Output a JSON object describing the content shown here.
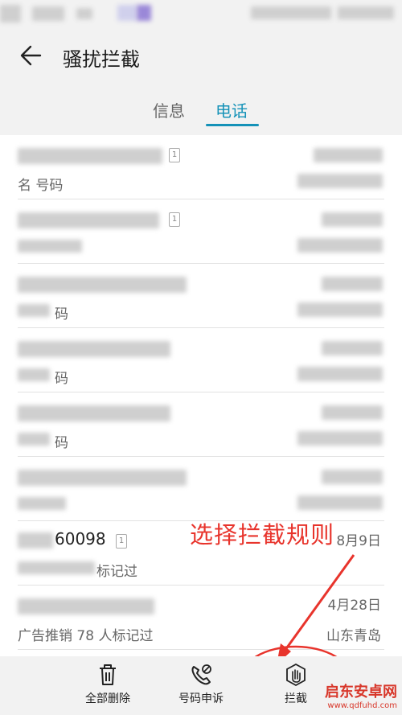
{
  "header": {
    "title": "骚扰拦截"
  },
  "tabs": [
    {
      "label": "信息"
    },
    {
      "label": "电话"
    }
  ],
  "rows": [
    {
      "sub": "名 号码"
    },
    {
      "sub": ""
    },
    {
      "sub": "码"
    },
    {
      "sub": "码"
    },
    {
      "sub": "码"
    },
    {
      "sub": ""
    },
    {
      "number": "60098",
      "sub": "标记过",
      "date": "8月9日"
    },
    {
      "sub": "广告推销 78 人标记过",
      "date": "4月28日",
      "location": "山东青岛"
    }
  ],
  "annotation": "选择拦截规则",
  "bottom_bar": [
    {
      "label": "全部删除",
      "icon": "trash-icon"
    },
    {
      "label": "号码申诉",
      "icon": "phone-block-icon"
    },
    {
      "label": "拦截",
      "icon": "hand-stop-icon"
    }
  ],
  "watermark": {
    "text": "启东安卓网",
    "url": "www.qdfuhd.com"
  },
  "colors": {
    "accent": "#1592b8",
    "annotation": "#e8342c"
  }
}
